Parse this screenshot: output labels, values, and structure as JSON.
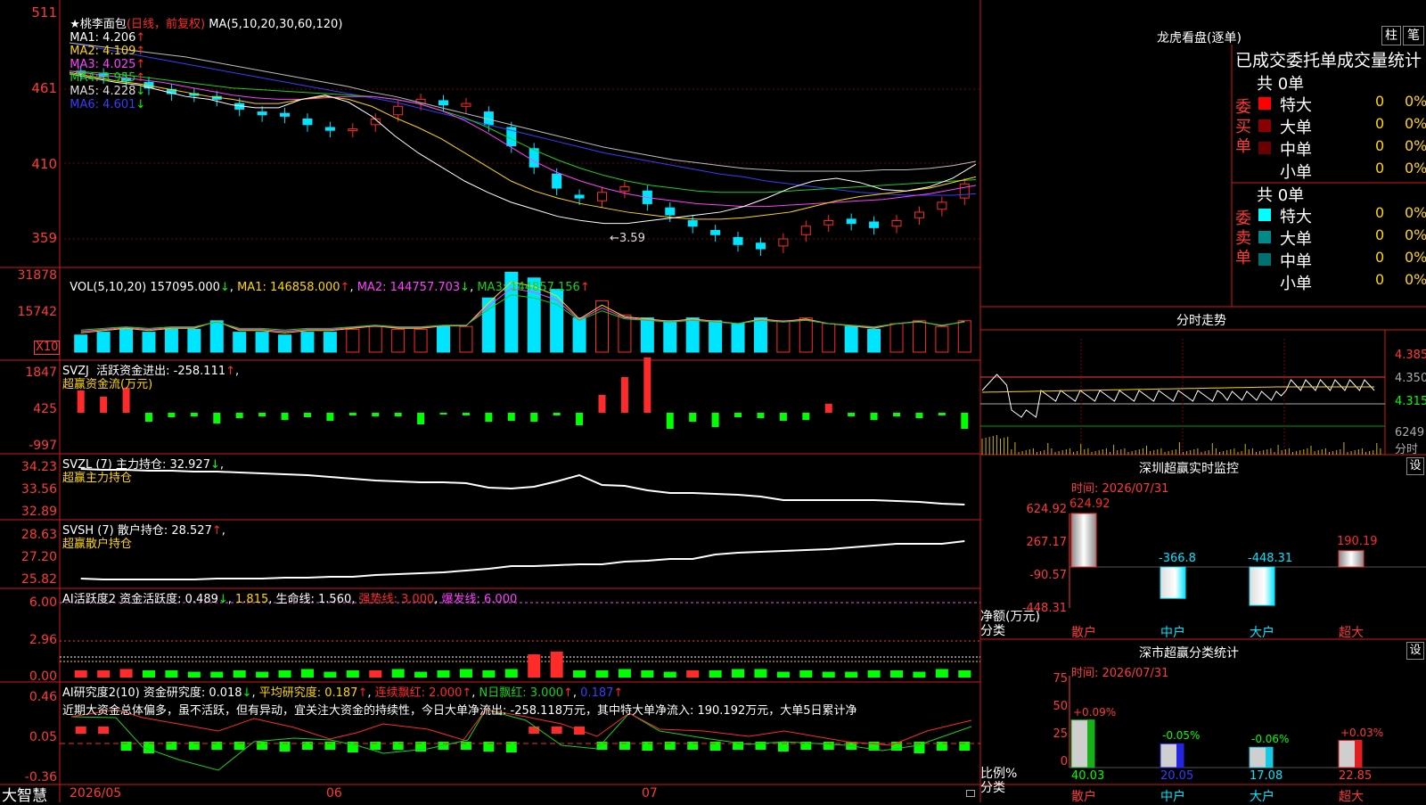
{
  "colors": {
    "up": "#ff2a2a",
    "down": "#00e5ff",
    "frame": "#d01818",
    "grid": "#7a0000",
    "text": "#ffffff",
    "yellow": "#ffd700",
    "magenta": "#ff40ff",
    "green": "#1bd01b",
    "blue": "#3b3bff",
    "axis": "#ff3a3a",
    "brightGreen": "#00ff00"
  },
  "header": {
    "star": "★",
    "name": "桃李面包",
    "period": "(日线，前复权)",
    "ma_spec": "MA(5,10,20,30,60,120)",
    "ma": [
      {
        "l": "MA1:",
        "v": "4.206",
        "a": "↑"
      },
      {
        "l": "MA2:",
        "v": "4.109",
        "a": "↑"
      },
      {
        "l": "MA3:",
        "v": "4.025",
        "a": "↑"
      },
      {
        "l": "MA4:",
        "v": "3.955",
        "a": "↑"
      },
      {
        "l": "MA5:",
        "v": "4.228",
        "a": "↓"
      },
      {
        "l": "MA6:",
        "v": "4.601",
        "a": "↓"
      }
    ]
  },
  "main_axis": [
    "511",
    "461",
    "410",
    "359"
  ],
  "low_label": "←3.59",
  "vol": {
    "title": "VOL(5,10,20)",
    "v": "157095.000",
    "a": "↓",
    "ma1": "MA1: 146858.000",
    "ma1a": "↑",
    "ma2": "MA2: 144757.703",
    "ma2a": "↓",
    "ma3": "MA3: 144857.156",
    "ma3a": "↑",
    "axis": [
      "31878",
      "15742"
    ],
    "unit": "X10"
  },
  "svzj": {
    "title": "SVZJ  活跃资金进出: -258.111",
    "a": "↑",
    "sub": "超赢资金流(万元)",
    "axis": [
      "1847",
      "425",
      "-997"
    ]
  },
  "svzl": {
    "title": "SVZL (7) 主力持仓: 32.927",
    "a": "↓",
    "sub": "超赢主力持仓",
    "axis": [
      "34.23",
      "33.56",
      "32.89"
    ]
  },
  "svsh": {
    "title": "SVSH (7) 散户持仓: 28.527",
    "a": "↑",
    "sub": "超赢散户持仓",
    "axis": [
      "28.63",
      "27.20",
      "25.82"
    ]
  },
  "ai1": {
    "p1": "AI活跃度2 资金活跃度: 0.489",
    "p1a": "↓",
    "p2": "1.815",
    "p3": "生命线: 1.560",
    "p4": "强势线: 3.000",
    "p5": "爆发线: 6.000",
    "axis": [
      "6.00",
      "2.96",
      "0.00"
    ]
  },
  "ai2": {
    "p1": "AI研究度2(10) 资金研究度: 0.018",
    "p1a": "↓",
    "p2": "平均研究度: 0.187",
    "p2a": "↑",
    "p3": "连续飘红: 2.000",
    "p3a": "↑",
    "p4": "N日飘红: 3.000",
    "p4a": "↑",
    "p5": "0.187",
    "p5a": "↑",
    "comment": "近期大资金总体偏多，虽不活跃，但有异动，宜关注大资金的持续性，今日大单净流出: -258.118万元，其中特大单净流入: 190.192万元，大单5日累计净",
    "axis": [
      "0.46",
      "0.05",
      "-0.36"
    ]
  },
  "footer": {
    "logo": "大智慧",
    "dates": [
      "2026/05",
      "06",
      "07"
    ]
  },
  "right": {
    "lhb_title": "龙虎看盘(逐单)",
    "btn1": "柱",
    "btn2": "笔",
    "stat_title": "已成交委托单成交量统计",
    "buy": {
      "label": "委买单",
      "total": "共 0单",
      "rows": [
        {
          "name": "特大",
          "v": "0",
          "p": "0%"
        },
        {
          "name": "大单",
          "v": "0",
          "p": "0%"
        },
        {
          "name": "中单",
          "v": "0",
          "p": "0%"
        },
        {
          "name": "小单",
          "v": "0",
          "p": "0%"
        }
      ]
    },
    "sell": {
      "label": "委卖单",
      "total": "共 0单",
      "rows": [
        {
          "name": "特大",
          "v": "0",
          "p": "0%"
        },
        {
          "name": "大单",
          "v": "0",
          "p": "0%"
        },
        {
          "name": "中单",
          "v": "0",
          "p": "0%"
        },
        {
          "name": "小单",
          "v": "0",
          "p": "0%"
        }
      ]
    },
    "intraday_title": "分时走势",
    "intraday_axis": [
      "4.385",
      "4.350",
      "4.315",
      "6249",
      "分时"
    ],
    "sz_title": "深圳超赢实时监控",
    "set": "设",
    "sz_time": "时间: 2026/07/31",
    "sz_axis": [
      "624.92",
      "267.17",
      "-90.57",
      "-448.31"
    ],
    "sz_unit": "净额(万元)",
    "sz_cat_label": "分类",
    "sz_bars": [
      {
        "name": "散户",
        "v": 624.92,
        "label": "624.92"
      },
      {
        "name": "中户",
        "v": -366.8,
        "label": "-366.8"
      },
      {
        "name": "大户",
        "v": -448.31,
        "label": "-448.31"
      },
      {
        "name": "超大",
        "v": 190.19,
        "label": "190.19"
      }
    ],
    "cls_title": "深市超赢分类统计",
    "cls_time": "时间: 2026/07/31",
    "cls_axis": [
      "75",
      "50",
      "25",
      "0"
    ],
    "cls_unit": "比例%",
    "cls_cat_label": "分类",
    "cls_bars": [
      {
        "name": "散户",
        "v": 40.03,
        "label": "40.03",
        "chg": "+0.09%"
      },
      {
        "name": "中户",
        "v": 20.05,
        "label": "20.05",
        "chg": "-0.05%"
      },
      {
        "name": "大户",
        "v": 17.08,
        "label": "17.08",
        "chg": "-0.06%"
      },
      {
        "name": "超大",
        "v": 22.85,
        "label": "22.85",
        "chg": "+0.03%"
      }
    ]
  }
}
